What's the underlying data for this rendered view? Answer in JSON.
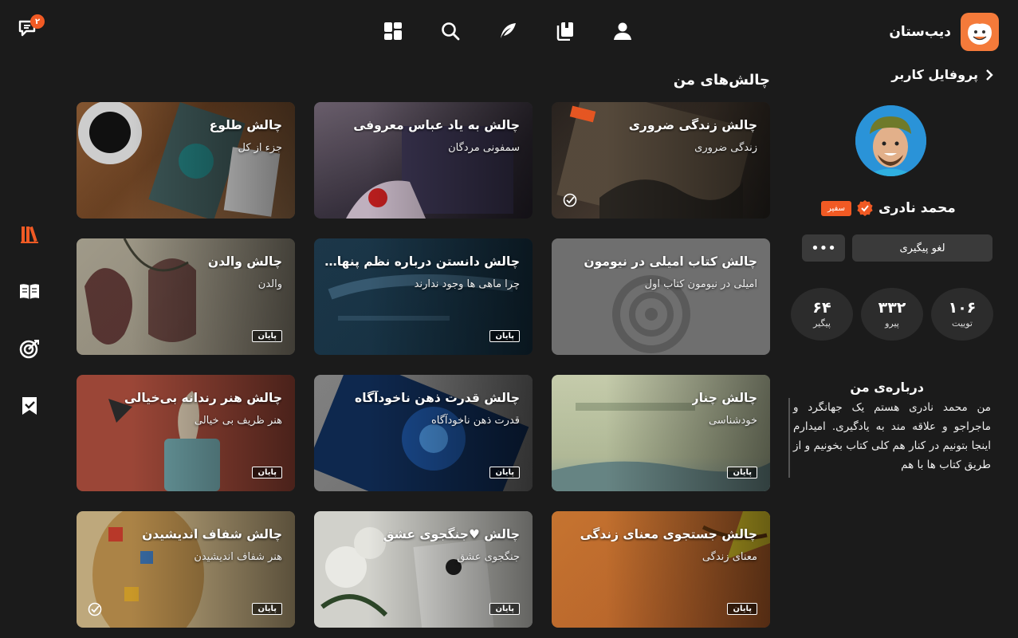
{
  "header": {
    "brand_name": "دیب‌ستان",
    "chat_badge": "۲",
    "nav_icons": [
      "dashboard-icon",
      "search-icon",
      "quill-icon",
      "library-icon",
      "user-icon"
    ]
  },
  "rail": {
    "items": [
      "books-icon",
      "open-book-icon",
      "target-icon",
      "bookmark-check-icon"
    ],
    "active_color": "#f15a24"
  },
  "section_title": "چالش‌های من",
  "cards": [
    {
      "title": "چالش طلوع",
      "subtitle": "جزء از کل",
      "tag": "",
      "check": false
    },
    {
      "title": "چالش به یاد عباس معروفی",
      "subtitle": "سمفونی مردگان",
      "tag": "",
      "check": false
    },
    {
      "title": "چالش زندگی ضروری",
      "subtitle": "زندگی ضروری",
      "tag": "",
      "check": true
    },
    {
      "title": "چالش والدن",
      "subtitle": "والدن",
      "tag": "پایان",
      "check": false
    },
    {
      "title": "چالش دانستن درباره نظم پنهان...",
      "subtitle": "چرا ماهی ها وجود ندارند",
      "tag": "پایان",
      "check": false
    },
    {
      "title": "چالش کتاب امیلی در نیومون",
      "subtitle": "امیلی در نیومون کتاب اول",
      "tag": "",
      "check": false
    },
    {
      "title": "چالش هنر رندانه بی‌خیالی",
      "subtitle": "هنر ظریف بی خیالی",
      "tag": "پایان",
      "check": false
    },
    {
      "title": "چالش قدرت ذهن ناخودآگاه",
      "subtitle": "قدرت ذهن ناخودآگاه",
      "tag": "پایان",
      "check": false
    },
    {
      "title": "چالش چنار",
      "subtitle": "خودشناسی",
      "tag": "پایان",
      "check": false
    },
    {
      "title": "چالش شفاف اندیشیدن",
      "subtitle": "هنر شفاف اندیشیدن",
      "tag": "پایان",
      "check": true
    },
    {
      "title": "چالش ♥جنگجوی عشق",
      "subtitle": "جنگجوی عشق",
      "tag": "پایان",
      "check": false
    },
    {
      "title": "چالش جستجوی معنای زندگی",
      "subtitle": "معنای زندگی",
      "tag": "پایان",
      "check": false
    }
  ],
  "profile": {
    "back_label": "پروفایل کاربر",
    "name": "محمد نادری",
    "badge": "سفیر",
    "unfollow_label": "لغو پیگیری",
    "more_label": "•••",
    "stats": [
      {
        "value": "۶۴",
        "label": "پیگیر"
      },
      {
        "value": "۳۳۲",
        "label": "پیرو"
      },
      {
        "value": "۱۰۶",
        "label": "توییت"
      }
    ],
    "about_title": "درباره‌ی من",
    "about_text": "من محمد نادری هستم یک جهانگرد و ماجراجو و علاقه مند به یادگیری. امیدارم اینجا بتونیم در کنار هم کلی کتاب بخونیم و از طریق کتاب ها با هم"
  }
}
